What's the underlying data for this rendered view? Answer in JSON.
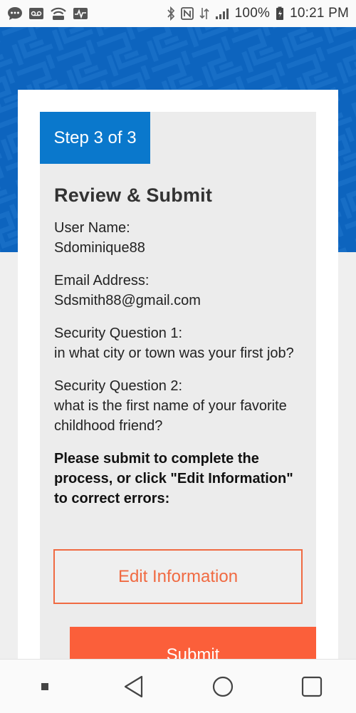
{
  "status_bar": {
    "battery_percent": "100%",
    "time": "10:21 PM",
    "left_icons": [
      "chat-bubble-icon",
      "voicemail-icon",
      "wifi-call-icon",
      "activity-icon"
    ],
    "right_icons": [
      "bluetooth-icon",
      "nfc-icon",
      "data-arrows-icon",
      "signal-icon",
      "battery-icon"
    ]
  },
  "step": {
    "label": "Step 3 of 3"
  },
  "review": {
    "title": "Review & Submit",
    "username_label": "User Name:",
    "username_value": "Sdominique88",
    "email_label": "Email Address:",
    "email_value": "Sdsmith88@gmail.com",
    "q1_label": "Security Question 1:",
    "q1_value": "in what city or town was your first job?",
    "q2_label": "Security Question 2:",
    "q2_value": "what is the first name of your favorite childhood friend?",
    "instruction": "Please submit to complete the process, or click \"Edit Information\" to correct errors:"
  },
  "buttons": {
    "edit_label": "Edit Information",
    "submit_label": "Submit"
  },
  "colors": {
    "banner": "#0d64be",
    "step_badge": "#0a78cc",
    "accent": "#f06a42",
    "submit": "#fb5f3a"
  },
  "nav_bar": {
    "items": [
      "recent-apps-dot-icon",
      "back-icon",
      "home-icon",
      "overview-icon"
    ]
  }
}
